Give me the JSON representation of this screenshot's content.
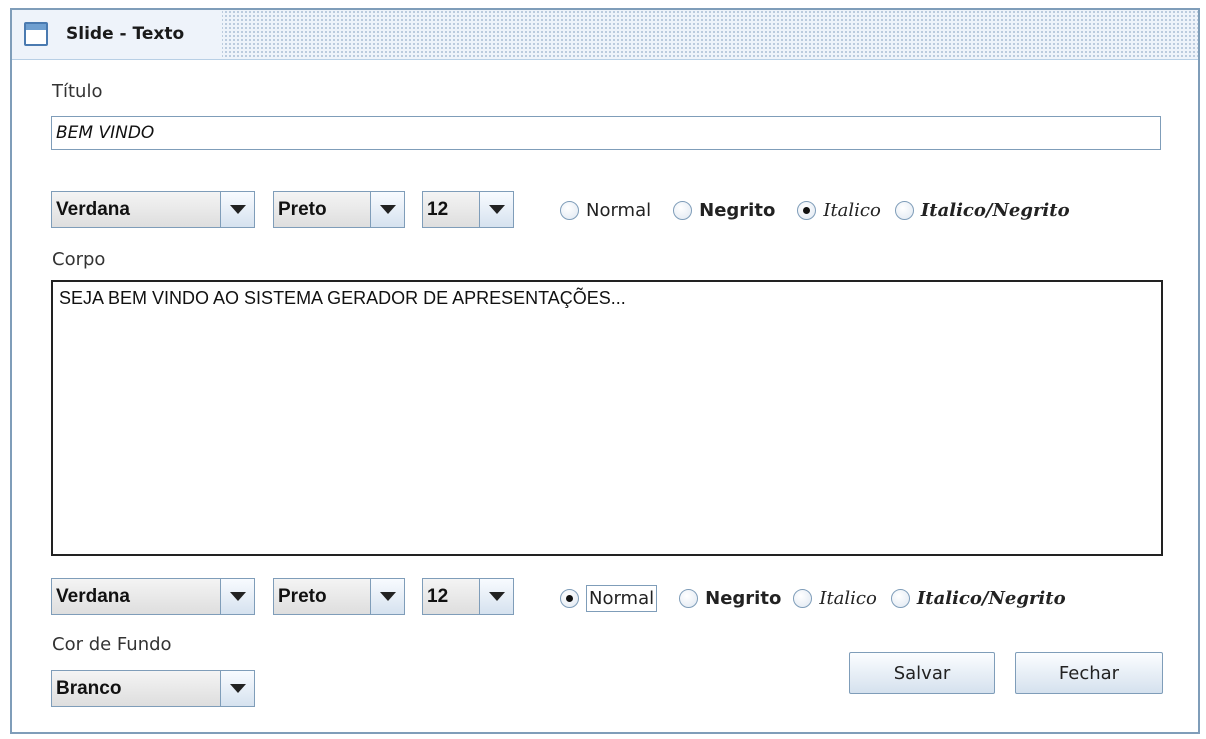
{
  "window": {
    "title": "Slide - Texto"
  },
  "titulo": {
    "label": "Título",
    "value": "BEM VINDO",
    "font": "Verdana",
    "color": "Preto",
    "size": "12",
    "styles": [
      "Normal",
      "Negrito",
      "Italico",
      "Italico/Negrito"
    ],
    "selected_style": "Italico"
  },
  "corpo": {
    "label": "Corpo",
    "value": "SEJA BEM VINDO AO SISTEMA GERADOR DE APRESENTAÇÕES...",
    "font": "Verdana",
    "color": "Preto",
    "size": "12",
    "styles": [
      "Normal",
      "Negrito",
      "Italico",
      "Italico/Negrito"
    ],
    "selected_style": "Normal"
  },
  "fundo": {
    "label": "Cor de Fundo",
    "value": "Branco"
  },
  "buttons": {
    "save": "Salvar",
    "close": "Fechar"
  }
}
